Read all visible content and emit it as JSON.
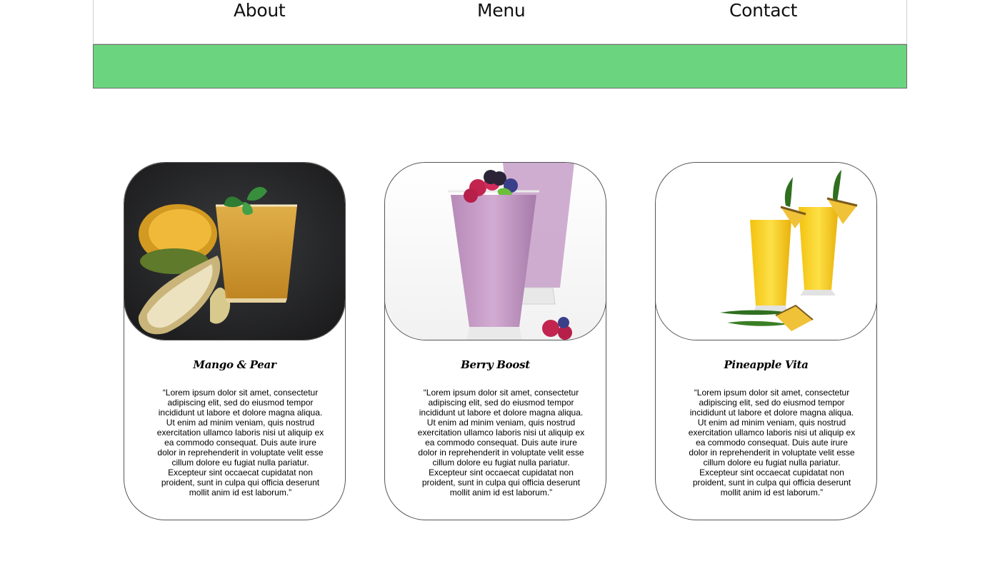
{
  "nav": {
    "items": [
      "About",
      "Menu",
      "Contact"
    ]
  },
  "banner": {
    "color": "#6bd47f"
  },
  "cards": [
    {
      "title": "Mango & Pear",
      "image": "mango-pear-smoothie-photo",
      "text": "“Lorem ipsum dolor sit amet, consectetur adipiscing elit, sed do eiusmod tempor incididunt ut labore et dolore magna aliqua. Ut enim ad minim veniam, quis nostrud exercitation ullamco laboris nisi ut aliquip ex ea commodo consequat. Duis aute irure dolor in reprehenderit in voluptate velit esse cillum dolore eu fugiat nulla pariatur. Excepteur sint occaecat cupidatat non proident, sunt in culpa qui officia deserunt mollit anim id est laborum.”"
    },
    {
      "title": "Berry Boost",
      "image": "berry-smoothie-photo",
      "text": "“Lorem ipsum dolor sit amet, consectetur adipiscing elit, sed do eiusmod tempor incididunt ut labore et dolore magna aliqua. Ut enim ad minim veniam, quis nostrud exercitation ullamco laboris nisi ut aliquip ex ea commodo consequat. Duis aute irure dolor in reprehenderit in voluptate velit esse cillum dolore eu fugiat nulla pariatur. Excepteur sint occaecat cupidatat non proident, sunt in culpa qui officia deserunt mollit anim id est laborum.”"
    },
    {
      "title": "Pineapple Vita",
      "image": "pineapple-juice-photo",
      "text": "“Lorem ipsum dolor sit amet, consectetur adipiscing elit, sed do eiusmod tempor incididunt ut labore et dolore magna aliqua. Ut enim ad minim veniam, quis nostrud exercitation ullamco laboris nisi ut aliquip ex ea commodo consequat. Duis aute irure dolor in reprehenderit in voluptate velit esse cillum dolore eu fugiat nulla pariatur. Excepteur sint occaecat cupidatat non proident, sunt in culpa qui officia deserunt mollit anim id est laborum.”"
    }
  ]
}
